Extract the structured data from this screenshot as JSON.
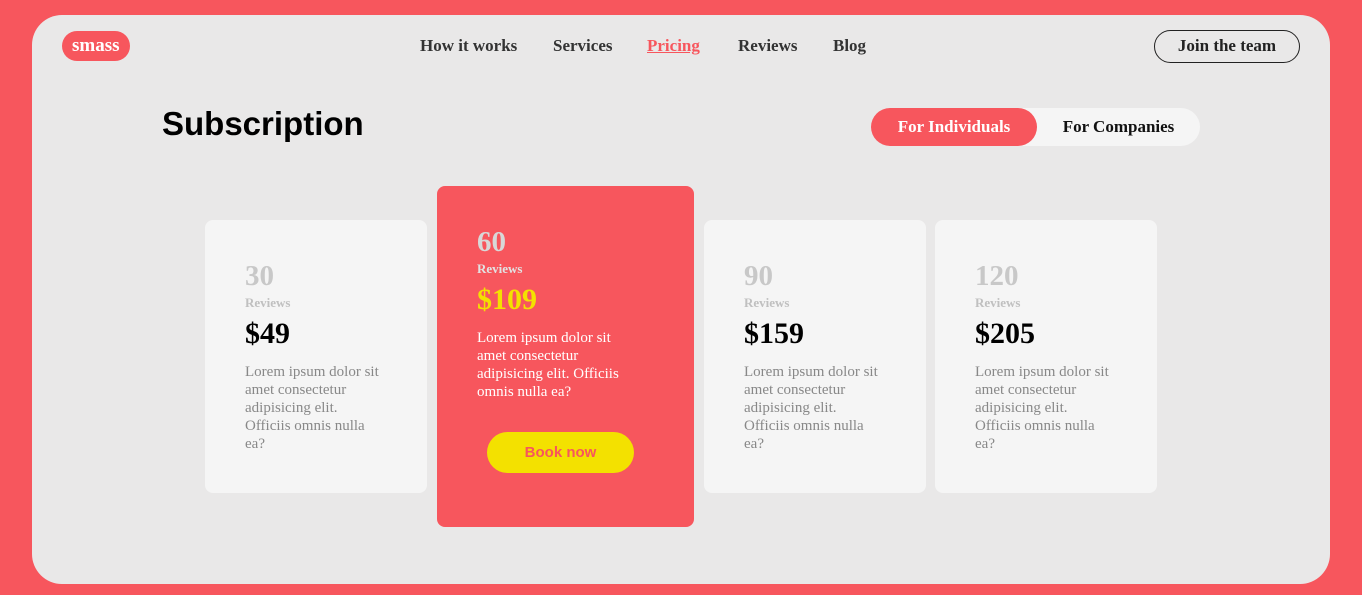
{
  "brand": "smass",
  "nav": [
    {
      "label": "How it works"
    },
    {
      "label": "Services"
    },
    {
      "label": "Pricing"
    },
    {
      "label": "Reviews"
    },
    {
      "label": "Blog"
    }
  ],
  "join_label": "Join the team",
  "title": "Subscription",
  "toggle": {
    "individuals": "For Individuals",
    "companies": "For Companies"
  },
  "cards": [
    {
      "count": "30",
      "unit": "Reviews",
      "price": "$49",
      "desc": "Lorem ipsum dolor sit amet consectetur adipisicing elit. Officiis omnis nulla ea?"
    },
    {
      "count": "60",
      "unit": "Reviews",
      "price": "$109",
      "desc": "Lorem ipsum dolor sit amet consectetur adipisicing elit. Officiis omnis nulla ea?",
      "button": "Book now"
    },
    {
      "count": "90",
      "unit": "Reviews",
      "price": "$159",
      "desc": "Lorem ipsum dolor sit amet consectetur adipisicing elit. Officiis omnis nulla ea?"
    },
    {
      "count": "120",
      "unit": "Reviews",
      "price": "$205",
      "desc": "Lorem ipsum dolor sit amet consectetur adipisicing elit. Officiis omnis nulla ea?"
    }
  ],
  "colors": {
    "accent": "#f7565d",
    "highlight": "#f3e100",
    "panel": "#e9e8e8"
  }
}
